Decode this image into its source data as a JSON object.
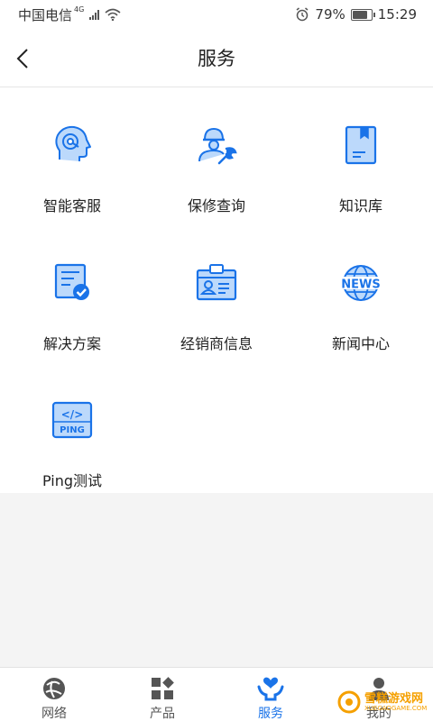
{
  "status_bar": {
    "carrier": "中国电信",
    "network": "4G",
    "battery": "79%",
    "battery_level": 0.79,
    "time": "15:29"
  },
  "header": {
    "title": "服务"
  },
  "services": [
    {
      "label": "智能客服",
      "icon": "customer-service-icon"
    },
    {
      "label": "保修查询",
      "icon": "warranty-icon"
    },
    {
      "label": "知识库",
      "icon": "knowledge-base-icon"
    },
    {
      "label": "解决方案",
      "icon": "solution-icon"
    },
    {
      "label": "经销商信息",
      "icon": "dealer-info-icon"
    },
    {
      "label": "新闻中心",
      "icon": "news-icon"
    },
    {
      "label": "Ping测试",
      "icon": "ping-test-icon"
    }
  ],
  "icon_text": {
    "news": "NEWS",
    "ping": "PING",
    "code": "</>"
  },
  "bottom_nav": [
    {
      "label": "网络",
      "icon": "network-icon",
      "active": false
    },
    {
      "label": "产品",
      "icon": "products-icon",
      "active": false
    },
    {
      "label": "服务",
      "icon": "services-icon",
      "active": true
    },
    {
      "label": "我的",
      "icon": "profile-icon",
      "active": false
    }
  ],
  "watermark": {
    "text": "雪糕游戏网",
    "sub": "XUEGAOGAME.COM"
  },
  "colors": {
    "accent": "#1a73e8",
    "icon_light": "#bcd9fb",
    "nav_gray": "#555555"
  }
}
